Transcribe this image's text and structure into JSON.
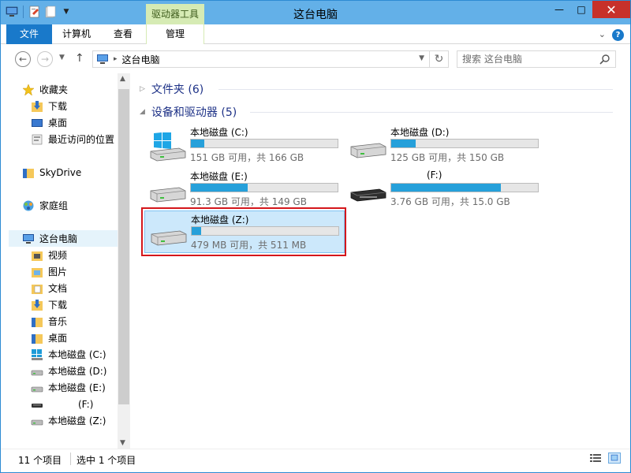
{
  "window": {
    "title": "这台电脑",
    "context_tab_group": "驱动器工具",
    "controls": {
      "minimize": "—",
      "maximize": "□",
      "close": "✕"
    }
  },
  "ribbon": {
    "tabs": [
      {
        "label": "文件"
      },
      {
        "label": "计算机"
      },
      {
        "label": "查看"
      },
      {
        "label": "管理"
      }
    ],
    "expand_glyph": "⌄",
    "help_glyph": "?"
  },
  "navigation": {
    "back": "←",
    "forward": "→",
    "recent_dropdown": "▼",
    "up": "↑",
    "address_chevron": "▸",
    "address_text": "这台电脑",
    "address_dropdown": "▼",
    "refresh": "↻",
    "search_placeholder": "搜索 这台电脑"
  },
  "nav_pane": {
    "favorites": {
      "label": "收藏夹",
      "icon": "star-icon",
      "items": [
        {
          "label": "下载",
          "icon": "downloads-folder-icon"
        },
        {
          "label": "桌面",
          "icon": "desktop-icon"
        },
        {
          "label": "最近访问的位置",
          "icon": "recent-places-icon"
        }
      ]
    },
    "skydrive": {
      "label": "SkyDrive",
      "icon": "skydrive-folder-icon"
    },
    "homegroup": {
      "label": "家庭组",
      "icon": "homegroup-icon"
    },
    "this_pc": {
      "label": "这台电脑",
      "icon": "computer-icon",
      "items": [
        {
          "label": "视频",
          "icon": "videos-folder-icon"
        },
        {
          "label": "图片",
          "icon": "pictures-folder-icon"
        },
        {
          "label": "文档",
          "icon": "documents-folder-icon"
        },
        {
          "label": "下载",
          "icon": "downloads-folder-icon"
        },
        {
          "label": "音乐",
          "icon": "music-folder-icon"
        },
        {
          "label": "桌面",
          "icon": "desktop-folder-icon"
        },
        {
          "label": "本地磁盘 (C:)",
          "icon": "windows-drive-icon"
        },
        {
          "label": "本地磁盘 (D:)",
          "icon": "drive-icon"
        },
        {
          "label": "本地磁盘 (E:)",
          "icon": "drive-icon"
        },
        {
          "label": "(F:)",
          "icon": "removable-drive-icon"
        },
        {
          "label": "本地磁盘 (Z:)",
          "icon": "drive-icon"
        }
      ]
    },
    "scroll_up": "▲",
    "scroll_down": "▼"
  },
  "content": {
    "folders_group": {
      "label": "文件夹 (6)",
      "collapsed_glyph": "▷"
    },
    "devices_group": {
      "label": "设备和驱动器 (5)",
      "expanded_glyph": "◢"
    },
    "drives": [
      {
        "name": "本地磁盘 (C:)",
        "info": "151 GB 可用，共 166 GB",
        "used_fraction": 0.09,
        "icon": "windows-drive-icon",
        "selected": false
      },
      {
        "name": "本地磁盘 (D:)",
        "info": "125 GB 可用，共 150 GB",
        "used_fraction": 0.167,
        "icon": "drive-icon",
        "selected": false
      },
      {
        "name": "本地磁盘 (E:)",
        "info": "91.3 GB 可用，共 149 GB",
        "used_fraction": 0.387,
        "icon": "drive-icon",
        "selected": false
      },
      {
        "name": "(F:)",
        "info": "3.76 GB 可用，共 15.0 GB",
        "used_fraction": 0.749,
        "icon": "removable-drive-icon",
        "selected": false
      },
      {
        "name": "本地磁盘 (Z:)",
        "info": "479 MB 可用，共 511 MB",
        "used_fraction": 0.063,
        "icon": "drive-icon",
        "selected": true
      }
    ]
  },
  "statusbar": {
    "item_count": "11 个项目",
    "selection": "选中 1 个项目"
  },
  "colors": {
    "accent": "#1979ca",
    "titlebar": "#63b0e8",
    "progress": "#26a0da",
    "selection": "#cce8fb",
    "highlight_box": "#d4171c"
  }
}
